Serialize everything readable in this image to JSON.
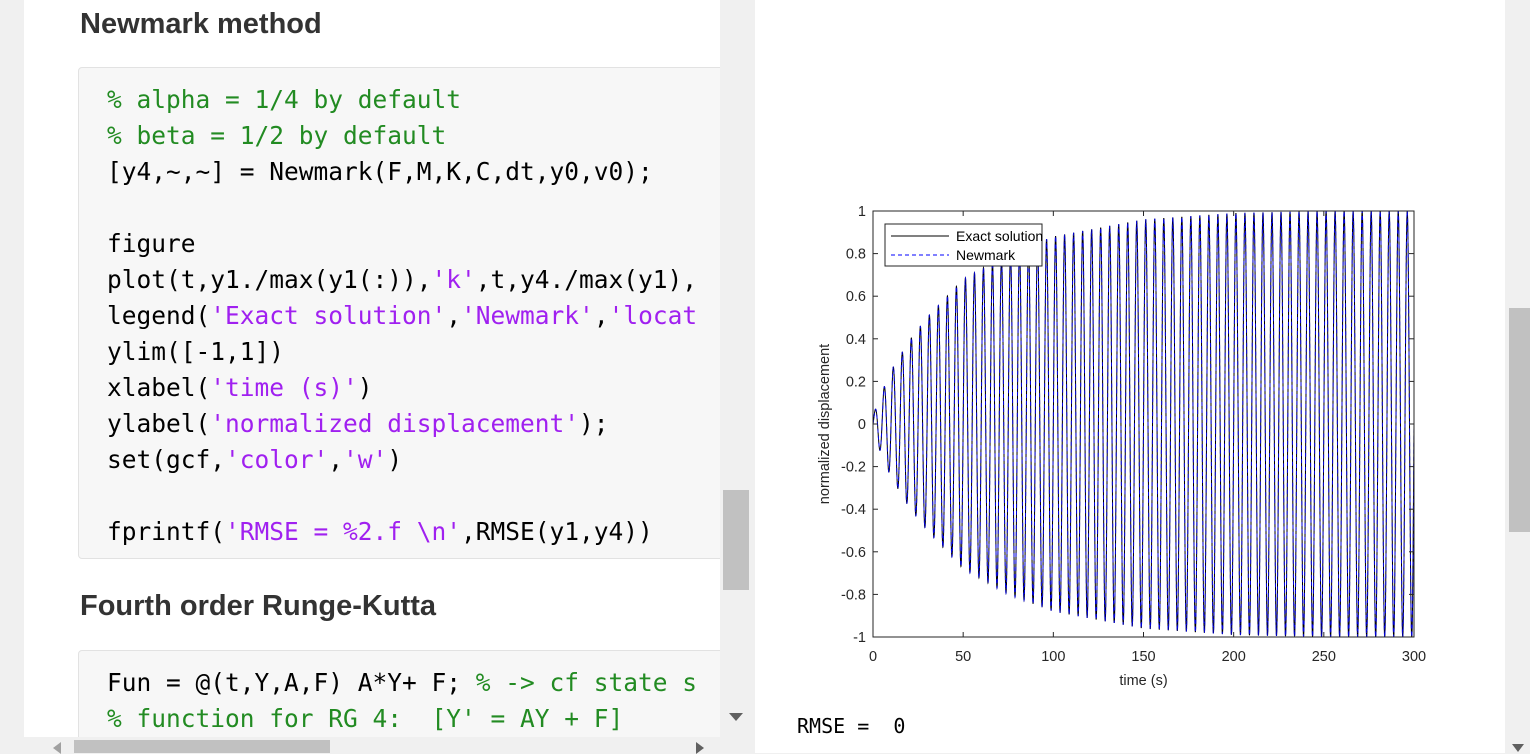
{
  "left": {
    "sections": [
      {
        "heading": "Newmark method",
        "code": [
          [
            {
              "t": "% alpha = 1/4 by default",
              "c": "cm"
            }
          ],
          [
            {
              "t": "% beta = 1/2 by default",
              "c": "cm"
            }
          ],
          [
            {
              "t": "[y4,~,~] = Newmark(F,M,K,C,dt,y0,v0);",
              "c": ""
            }
          ],
          [
            {
              "t": "",
              "c": ""
            }
          ],
          [
            {
              "t": "figure",
              "c": ""
            }
          ],
          [
            {
              "t": "plot(t,y1./max(y1(:)),",
              "c": ""
            },
            {
              "t": "'k'",
              "c": "st"
            },
            {
              "t": ",t,y4./max(y1),",
              "c": ""
            }
          ],
          [
            {
              "t": "legend(",
              "c": ""
            },
            {
              "t": "'Exact solution'",
              "c": "st"
            },
            {
              "t": ",",
              "c": ""
            },
            {
              "t": "'Newmark'",
              "c": "st"
            },
            {
              "t": ",",
              "c": ""
            },
            {
              "t": "'locat",
              "c": "st"
            }
          ],
          [
            {
              "t": "ylim([-1,1])",
              "c": ""
            }
          ],
          [
            {
              "t": "xlabel(",
              "c": ""
            },
            {
              "t": "'time (s)'",
              "c": "st"
            },
            {
              "t": ")",
              "c": ""
            }
          ],
          [
            {
              "t": "ylabel(",
              "c": ""
            },
            {
              "t": "'normalized displacement'",
              "c": "st"
            },
            {
              "t": ");",
              "c": ""
            }
          ],
          [
            {
              "t": "set(gcf,",
              "c": ""
            },
            {
              "t": "'color'",
              "c": "st"
            },
            {
              "t": ",",
              "c": ""
            },
            {
              "t": "'w'",
              "c": "st"
            },
            {
              "t": ")",
              "c": ""
            }
          ],
          [
            {
              "t": "",
              "c": ""
            }
          ],
          [
            {
              "t": "fprintf(",
              "c": ""
            },
            {
              "t": "'RMSE = %2.f \\n'",
              "c": "st"
            },
            {
              "t": ",RMSE(y1,y4))",
              "c": ""
            }
          ]
        ]
      },
      {
        "heading": "Fourth order Runge-Kutta",
        "code": [
          [
            {
              "t": "Fun = @(t,Y,A,F) A*Y+ F; ",
              "c": ""
            },
            {
              "t": "% -> cf state s",
              "c": "cm"
            }
          ],
          [
            {
              "t": "% function for RG 4:  [Y' = AY + F]",
              "c": "cm"
            }
          ]
        ]
      }
    ]
  },
  "right": {
    "output_text": "RMSE =  0"
  },
  "colors": {
    "comment": "#228b22",
    "string": "#a020f0",
    "exact_line": "#000000",
    "newmark_line": "#0000ff"
  },
  "chart_data": {
    "type": "line",
    "title": "",
    "xlabel": "time (s)",
    "ylabel": "normalized displacement",
    "xlim": [
      0,
      300
    ],
    "ylim": [
      -1,
      1
    ],
    "xticks": [
      0,
      50,
      100,
      150,
      200,
      250,
      300
    ],
    "yticks": [
      -1,
      -0.8,
      -0.6,
      -0.4,
      -0.2,
      0,
      0.2,
      0.4,
      0.6,
      0.8,
      1
    ],
    "legend_position": "top-left",
    "series": [
      {
        "name": "Exact solution",
        "style": "solid",
        "color": "#000000",
        "description": "oscillation with period about 5 s, amplitude growing from about 0.04 near t=0 to 1 at t=300"
      },
      {
        "name": "Newmark",
        "style": "dashed",
        "color": "#0000ff",
        "description": "overlaps the exact solution"
      }
    ],
    "period": 5,
    "envelope": {
      "x": [
        0,
        5,
        10,
        20,
        30,
        50,
        75,
        100,
        150,
        200,
        250,
        300
      ],
      "y": [
        0.04,
        0.15,
        0.25,
        0.39,
        0.5,
        0.68,
        0.8,
        0.88,
        0.96,
        0.99,
        1.0,
        1.0
      ]
    }
  }
}
